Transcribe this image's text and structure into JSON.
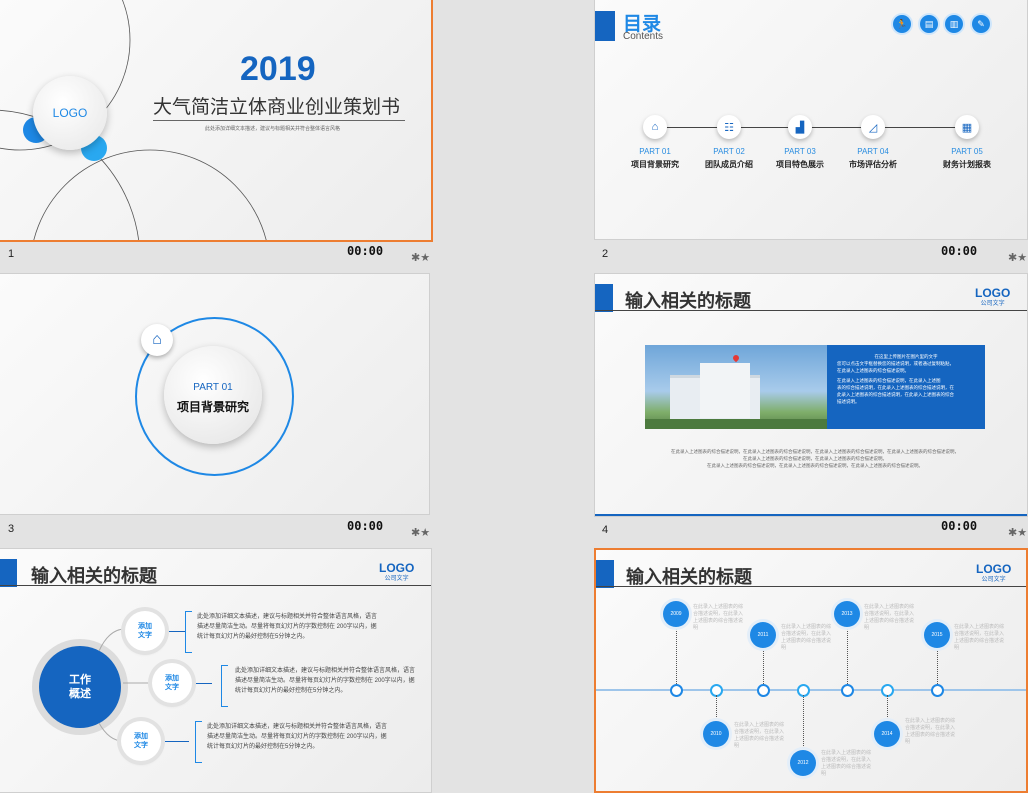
{
  "slides": [
    {
      "number": "1",
      "time": "00:00",
      "year": "2019",
      "title": "大气简洁立体商业创业策划书",
      "subtitle": "此处添加详细文本描述，建议与标题相关并符合整体语言风格",
      "logo": "LOGO"
    },
    {
      "number": "2",
      "time": "00:00",
      "title": "目录",
      "title_en": "Contents",
      "parts": [
        {
          "tag": "PART 01",
          "name": "项目背景研究",
          "icon": "home-icon"
        },
        {
          "tag": "PART 02",
          "name": "团队成员介绍",
          "icon": "team-icon"
        },
        {
          "tag": "PART 03",
          "name": "项目特色展示",
          "icon": "podium-icon"
        },
        {
          "tag": "PART 04",
          "name": "市场评估分析",
          "icon": "chart-icon"
        },
        {
          "tag": "PART 05",
          "name": "财务计划报表",
          "icon": "coins-icon"
        }
      ]
    },
    {
      "number": "3",
      "time": "00:00",
      "part_tag": "PART 01",
      "part_name": "项目背景研究"
    },
    {
      "number": "4",
      "time": "00:00",
      "title": "输入相关的标题",
      "logo": "LOGO",
      "logo_sub": "公司文字",
      "panel_lines": [
        "在这里上传图片在图片里的文字",
        "您可以点击文字框替换您的描述说明，或者通过复制粘贴，",
        "在此录入上述图表的综合描述说明。",
        "在此录入上述图表的综合描述说明，在此录入上述图",
        "表的综合描述说明，在此录入上述图表的综合描述说明，在",
        "此录入上述图表的综合描述说明，在此录入上述图表的综合",
        "描述说明。"
      ],
      "body_lines": [
        "在此录入上述图表的综合描述说明，在此录入上述图表的综合描述说明，在此录入上述图表的综合描述说明，在此录入上述图表的综合描述说明，",
        "在此录入上述图表的综合描述说明，在此录入上述图表的综合描述说明。",
        "在此录入上述图表的综合描述说明，在此录入上述图表的综合描述说明，在此录入上述图表的综合描述说明。"
      ]
    },
    {
      "number": "5",
      "title": "输入相关的标题",
      "logo": "LOGO",
      "logo_sub": "公司文字",
      "center": "工作\n概述",
      "items": [
        {
          "label": "添加\n文字",
          "text": "此处添加详细文本描述，建议与标题相关并符合整体语言风格，语言描述尽量简洁生动。尽量将每页幻灯片的字数控制在 200字以内，据统计每页幻灯片的最好控制在5分钟之内。"
        },
        {
          "label": "添加\n文字",
          "text": "此处添加详细文本描述，建议与标题相关并符合整体语言风格，语言描述尽量简洁生动。尽量将每页幻灯片的字数控制在 200字以内，据统计每页幻灯片的最好控制在5分钟之内。"
        },
        {
          "label": "添加\n文字",
          "text": "此处添加详细文本描述，建议与标题相关并符合整体语言风格，语言描述尽量简洁生动。尽量将每页幻灯片的字数控制在 200字以内，据统计每页幻灯片的最好控制在5分钟之内。"
        }
      ]
    },
    {
      "number": "6",
      "title": "输入相关的标题",
      "logo": "LOGO",
      "logo_sub": "公司文字",
      "years": [
        "2009",
        "2010",
        "2011",
        "2012",
        "2013",
        "2014",
        "2015"
      ],
      "tl_text": "在此录入上述图表的综合描述说明，在此录入上述图表的综合描述说明"
    }
  ],
  "colors": {
    "accent": "#1565c0",
    "selection": "#ed7d31"
  }
}
